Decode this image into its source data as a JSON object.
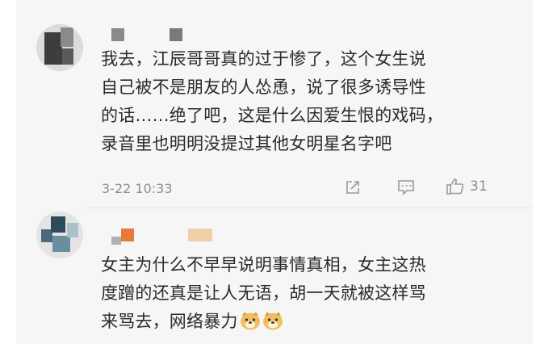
{
  "comments": [
    {
      "text_lines": [
        "我去，江辰哥哥真的过于惨了，这个女生说",
        "自己被不是朋友的人怂恿，说了很多诱导性",
        "的话……绝了吧，这是什么因爱生恨的戏码，",
        "录音里也明明没提过其他女明星名字吧"
      ],
      "timestamp": "3-22 10:33",
      "like_count": "31",
      "icons": [
        "share-icon",
        "comment-icon",
        "like-icon"
      ]
    },
    {
      "text_lines": [
        "女主为什么不早早说明事情真相，女主这热",
        "度蹭的还真是让人无语，胡一天就被这样骂",
        "来骂去，网络暴力"
      ],
      "emojis": [
        "doge-emoji",
        "doge-emoji"
      ]
    }
  ],
  "colors": {
    "background": "#f6f6f6",
    "text": "#2a2a2a",
    "meta": "#8f8f8f",
    "name_blur_1": "#8a8a8a",
    "name_blur_orange": "#e8793a"
  }
}
